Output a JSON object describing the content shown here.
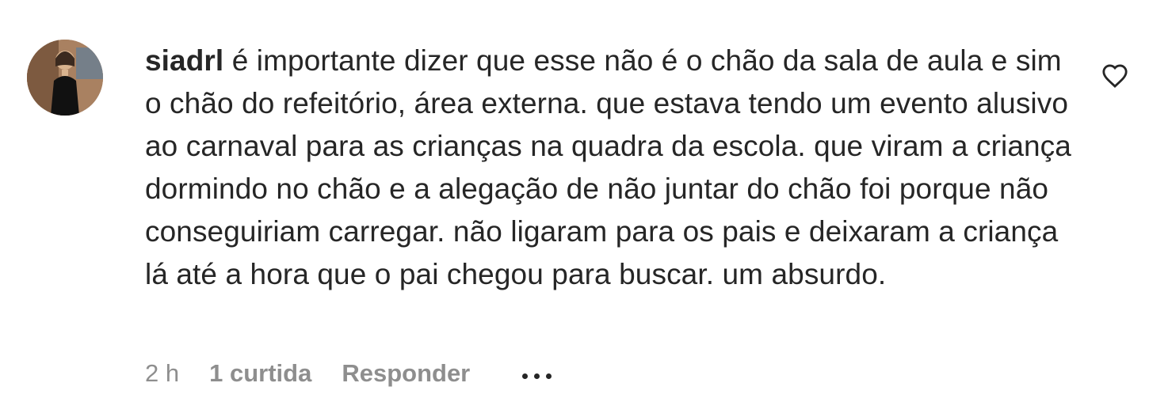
{
  "comment": {
    "username": "siadrl",
    "text": "é importante dizer que esse não é o chão da sala de aula e sim o chão do refeitório, área externa. que estava tendo um evento alusivo ao carnaval para as crianças na quadra da escola. que viram a criança dormindo no chão e a alegação de não juntar do chão foi porque não conseguiriam carregar. não ligaram para os pais e deixaram a criança lá até a hora que o pai chegou para buscar. um absurdo.",
    "time": "2 h",
    "likes": "1 curtida",
    "reply_label": "Responder",
    "like_icon": "heart-outline-icon",
    "more_icon": "more-horizontal-icon"
  },
  "colors": {
    "text": "#262626",
    "secondary": "#8e8e8e",
    "background": "#ffffff"
  }
}
